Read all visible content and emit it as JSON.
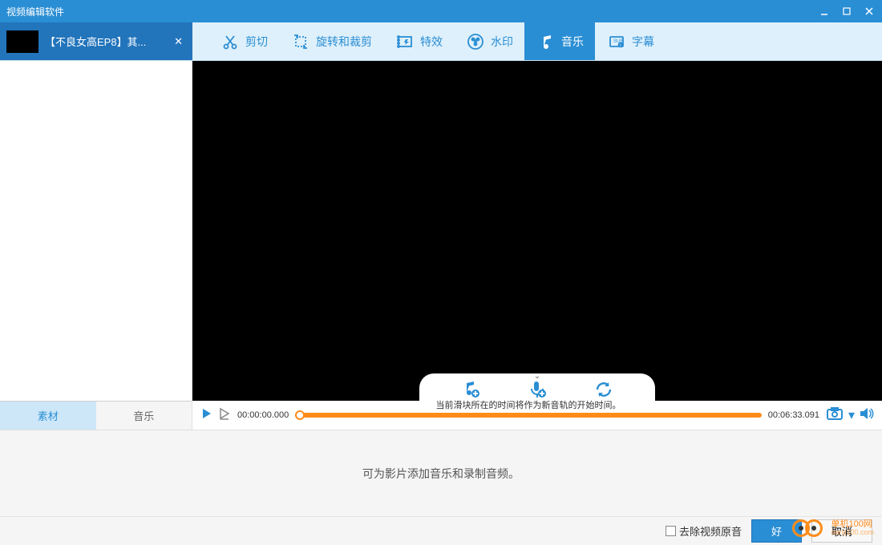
{
  "window": {
    "title": "视频编辑软件"
  },
  "file_tab": {
    "name": "【不良女高EP8】其..."
  },
  "toolbar": {
    "items": [
      {
        "label": "剪切"
      },
      {
        "label": "旋转和裁剪"
      },
      {
        "label": "特效"
      },
      {
        "label": "水印"
      },
      {
        "label": "音乐"
      },
      {
        "label": "字幕"
      }
    ],
    "active_index": 4
  },
  "sidebar": {
    "tabs": [
      "素材",
      "音乐"
    ],
    "active_tab": 0
  },
  "timeline": {
    "current_time": "00:00:00.000",
    "total_time": "00:06:33.091",
    "hint": "当前滑块所在的时间将作为新音轨的开始时间。"
  },
  "bottom_panel": {
    "message": "可为影片添加音乐和录制音频。"
  },
  "footer": {
    "checkbox_label": "去除视频原音",
    "ok_button": "好",
    "cancel_button": "取消"
  },
  "watermark": {
    "line1": "单机100网",
    "line2": "danji100.com"
  }
}
